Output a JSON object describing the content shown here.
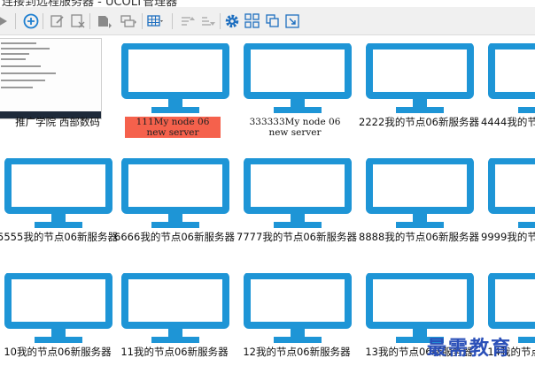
{
  "window": {
    "title": "连接到远程服务器 - UCOLT管理器"
  },
  "toolbar": {
    "buttons": [
      {
        "name": "play-icon",
        "icon": "play"
      },
      {
        "name": "add-circle-icon",
        "icon": "plus-circle"
      },
      {
        "name": "edit-icon",
        "icon": "edit"
      },
      {
        "name": "delete-icon",
        "icon": "delete"
      },
      {
        "name": "import-icon",
        "icon": "import"
      },
      {
        "name": "group-icon",
        "icon": "group"
      },
      {
        "name": "table-view-icon",
        "icon": "table"
      },
      {
        "name": "sort-asc-icon",
        "icon": "sort-asc"
      },
      {
        "name": "sort-desc-icon",
        "icon": "sort-desc"
      },
      {
        "name": "gear-icon",
        "icon": "gear"
      },
      {
        "name": "grid-view-icon",
        "icon": "grid"
      },
      {
        "name": "copy-icon",
        "icon": "copy"
      },
      {
        "name": "expand-icon",
        "icon": "expand"
      }
    ]
  },
  "colors": {
    "monitor": "#1e95d6",
    "selected": "#f5614c",
    "watermark": "#2a4fb8"
  },
  "servers": [
    {
      "caption": "推广学院  西部数码",
      "thumbnail": true
    },
    {
      "caption": "111My node 06 new server",
      "selected": true
    },
    {
      "caption": "333333My node 06 new server"
    },
    {
      "caption": "2222我的节点06新服务器"
    },
    {
      "caption": "4444我的节点06新服务器"
    },
    {
      "caption": "5555我的节点06新服务器"
    },
    {
      "caption": "6666我的节点06新服务器"
    },
    {
      "caption": "7777我的节点06新服务器"
    },
    {
      "caption": "8888我的节点06新服务器"
    },
    {
      "caption": "9999我的节点06新服务器"
    },
    {
      "caption": "10我的节点06新服务器"
    },
    {
      "caption": "11我的节点06新服务器"
    },
    {
      "caption": "12我的节点06新服务器"
    },
    {
      "caption": "13我的节点06新服务器"
    },
    {
      "caption": "14我的节点06新服务器"
    }
  ],
  "watermark": "最需教育"
}
